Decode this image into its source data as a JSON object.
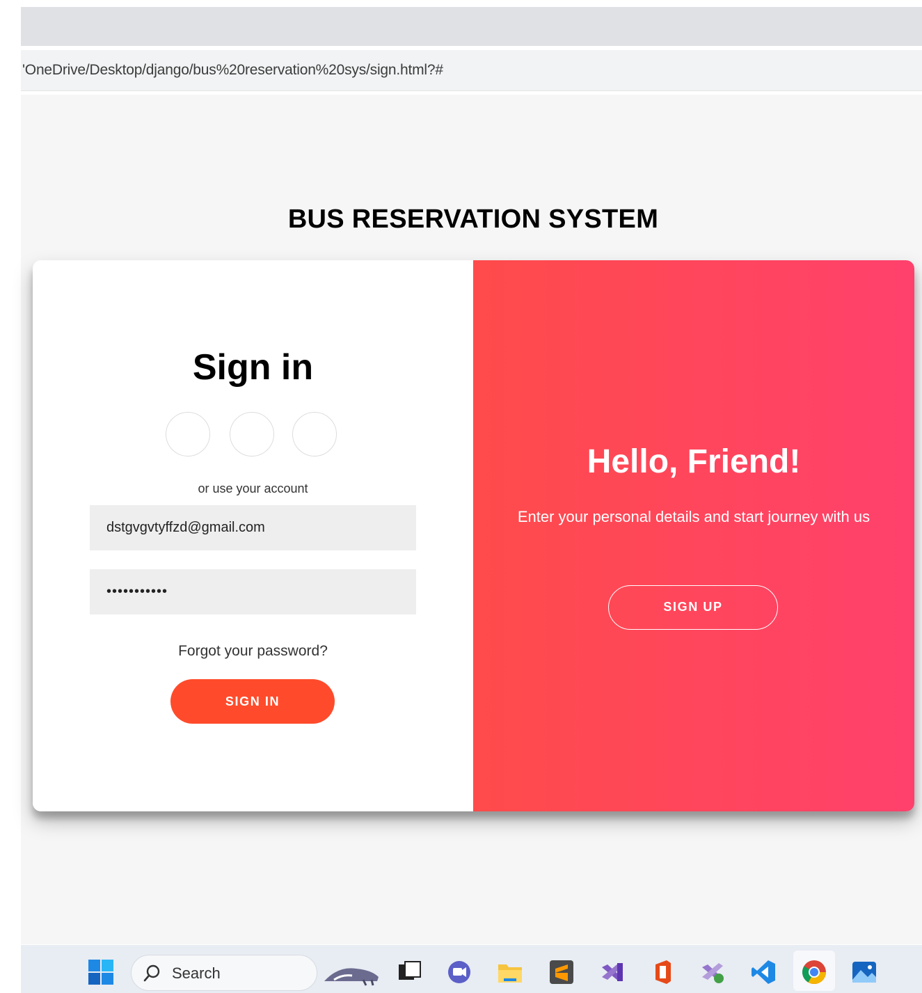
{
  "browser": {
    "address": "'OneDrive/Desktop/django/bus%20reservation%20sys/sign.html?#"
  },
  "page": {
    "title": "BUS RESERVATION SYSTEM"
  },
  "signin": {
    "heading": "Sign in",
    "or_text": "or use your account",
    "email_value": "dstgvgvtyffzd@gmail.com",
    "password_value": "•••••••••••",
    "forgot_link": "Forgot your password?",
    "button_label": "SIGN IN"
  },
  "overlay": {
    "heading": "Hello, Friend!",
    "description": "Enter your personal details and start journey with us",
    "button_label": "SIGN UP"
  },
  "taskbar": {
    "search_label": "Search",
    "icons": [
      "windows-start-icon",
      "search-icon",
      "anteater-widget-icon",
      "task-view-icon",
      "chat-icon",
      "file-explorer-icon",
      "sublime-text-icon",
      "visual-studio-icon",
      "office-icon",
      "visual-studio-preview-icon",
      "vscode-icon",
      "chrome-icon",
      "photos-icon"
    ]
  },
  "colors": {
    "signin_button": "#ff4b2b",
    "overlay_gradient_start": "#ff4b4b",
    "overlay_gradient_end": "#ff416c"
  }
}
